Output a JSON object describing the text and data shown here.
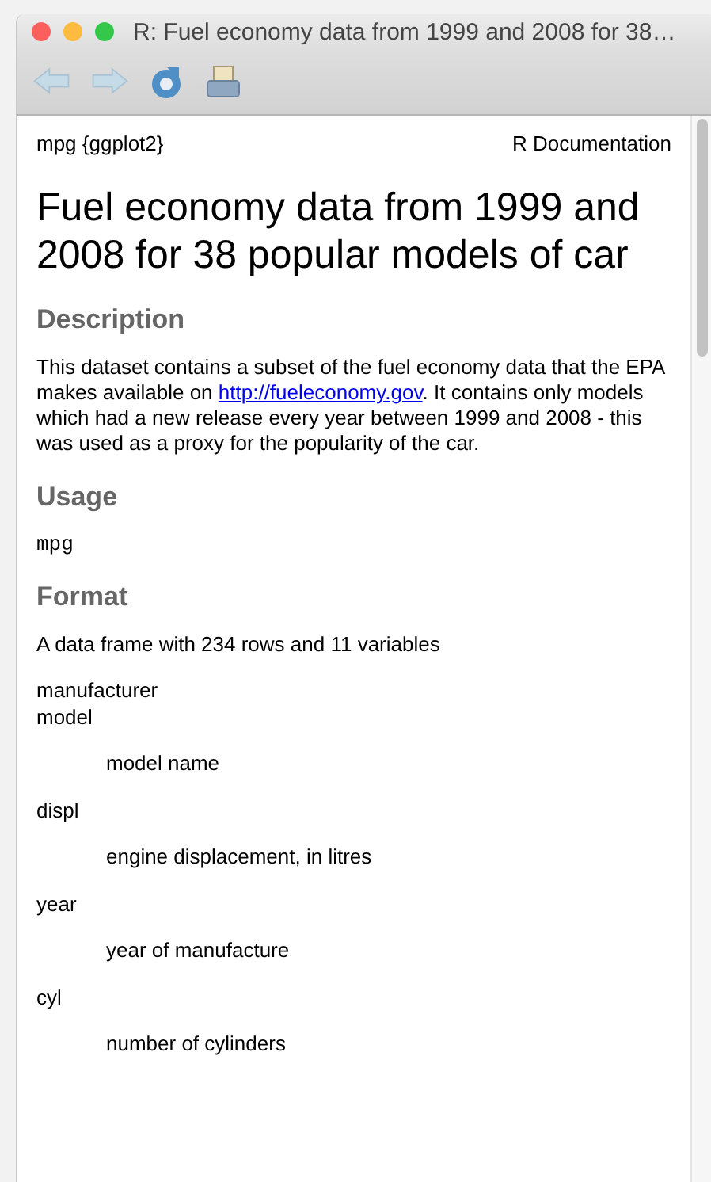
{
  "window": {
    "title": "R: Fuel economy data from 1999 and 2008 for 38…"
  },
  "toolbar": [
    {
      "kind": "back",
      "disabled": true
    },
    {
      "kind": "forward",
      "disabled": true
    },
    {
      "kind": "reload",
      "disabled": false
    },
    {
      "kind": "print",
      "disabled": false
    }
  ],
  "header": {
    "left": "mpg {ggplot2}",
    "right": "R Documentation"
  },
  "title": "Fuel economy data from 1999 and 2008 for 38 popular models of car",
  "sections": [
    {
      "kind": "paragraph",
      "heading": "Description",
      "before": "This dataset contains a subset of the fuel economy data that the EPA makes available on ",
      "link": "http://fueleconomy.gov",
      "after": ". It contains only models which had a new release every year between 1999 and 2008 - this was used as a proxy for the popularity of the car."
    },
    {
      "kind": "code",
      "heading": "Usage",
      "code": "mpg"
    },
    {
      "kind": "format",
      "heading": "Format",
      "intro": "A data frame with 234 rows and 11 variables",
      "variables": [
        {
          "name": "manufacturer"
        },
        {
          "name": "model",
          "description": "model name"
        },
        {
          "name": "displ",
          "description": "engine displacement, in litres"
        },
        {
          "name": "year",
          "description": "year of manufacture"
        },
        {
          "name": "cyl",
          "description": "number of cylinders"
        }
      ]
    }
  ]
}
